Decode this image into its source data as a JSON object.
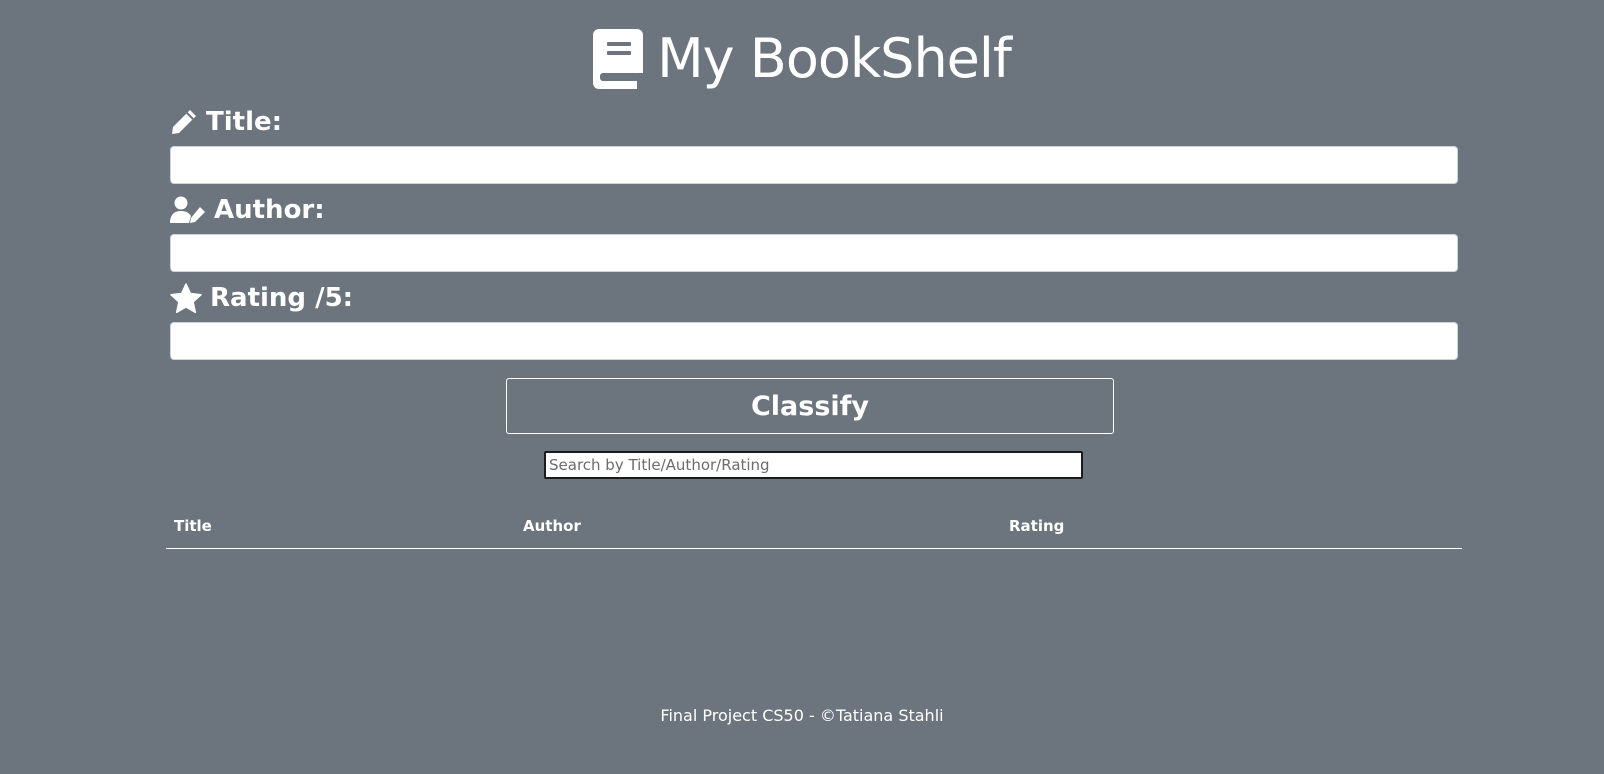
{
  "header": {
    "title": "My BookShelf",
    "icon": "book-icon"
  },
  "form": {
    "title_label": "Title:",
    "title_icon": "pencil-icon",
    "title_value": "",
    "author_label": "Author:",
    "author_icon": "user-pen-icon",
    "author_value": "",
    "rating_label": "Rating /5:",
    "rating_icon": "star-icon",
    "rating_value": "",
    "submit_label": "Classify"
  },
  "search": {
    "placeholder": "Search by Title/Author/Rating",
    "value": ""
  },
  "table": {
    "columns": [
      "Title",
      "Author",
      "Rating"
    ],
    "rows": []
  },
  "footer": {
    "text": "Final Project CS50 - ©Tatiana Stahli"
  },
  "colors": {
    "background": "#6c757d",
    "text": "#ffffff",
    "input_background": "#ffffff"
  }
}
